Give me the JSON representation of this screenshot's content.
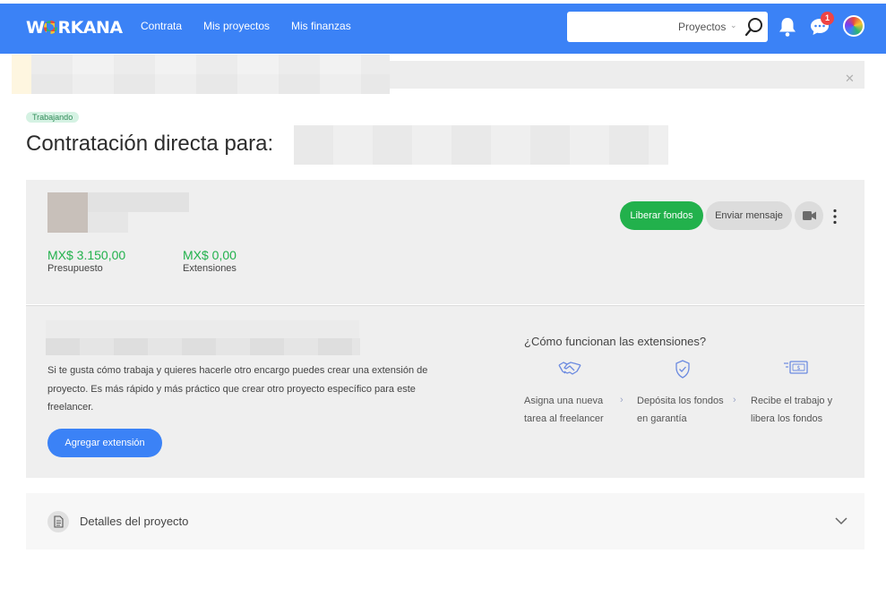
{
  "header": {
    "logo": "WORKANA",
    "logo_pre": "W",
    "logo_post": "RKANA",
    "nav": [
      "Contrata",
      "Mis proyectos",
      "Mis finanzas"
    ],
    "search": {
      "placeholder": "",
      "scope": "Proyectos"
    },
    "notifications_badge": "1"
  },
  "project": {
    "status": "Trabajando",
    "title": "Contratación directa para:"
  },
  "contract": {
    "budget": {
      "amount": "MX$ 3.150,00",
      "label": "Presupuesto"
    },
    "extensions": {
      "amount": "MX$ 0,00",
      "label": "Extensiones"
    },
    "actions": {
      "release": "Liberar fondos",
      "message": "Enviar mensaje"
    }
  },
  "extension": {
    "description": "Si te gusta cómo trabaja y quieres hacerle otro encargo puedes crear una extensión de proyecto. Es más rápido y más práctico que crear otro proyecto específico para este freelancer.",
    "button": "Agregar extensión",
    "how_title": "¿Cómo funcionan las extensiones?",
    "steps": [
      {
        "icon": "handshake-icon",
        "text": "Asigna una nueva tarea al freelancer"
      },
      {
        "icon": "shield-check-icon",
        "text": "Depósita los fondos en garantía"
      },
      {
        "icon": "money-icon",
        "text": "Recibe el trabajo y libera los fondos"
      }
    ]
  },
  "details": {
    "label": "Detalles del proyecto"
  },
  "colors": {
    "header": "#3b82f6",
    "green": "#22b14c",
    "blue": "#3b82f6",
    "badge": "#ef4444"
  }
}
